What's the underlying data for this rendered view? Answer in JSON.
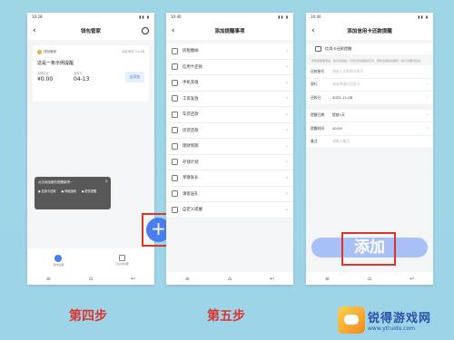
{
  "phone1": {
    "time": "10:28",
    "title": "钱包管家",
    "card": {
      "brand": "钱包管家",
      "date": "4月28日 11:08",
      "title": "这是一条示例提醒",
      "amount_label": "本期应还",
      "amount": "¥0.00",
      "date_label": "还款日",
      "date_value": "04-13",
      "button": "去添加"
    },
    "popup": {
      "title": "点击添加新的提醒事项~",
      "close": "×",
      "items": [
        "信用卡还款",
        "房租缴纳",
        "更多提醒"
      ]
    },
    "fab": "+",
    "tabs": [
      "我的提醒",
      "已完成提醒"
    ]
  },
  "phone2": {
    "time": "10:40",
    "title": "添加提醒事项",
    "items": [
      "房租缴纳",
      "信用卡还款",
      "手机充值",
      "工资发放",
      "车贷还款",
      "房贷还款",
      "理财到期",
      "存钱计划",
      "孝敬家长",
      "请客送礼",
      "自定义提醒"
    ]
  },
  "phone3": {
    "time": "10:40",
    "title": "添加信用卡还款提醒",
    "card_label": "信用卡还款提醒",
    "note": "添加提醒事项后，我们将提前一天和当天提醒您还款，帮助您避免逾期和一些不必要的损失。",
    "rows": [
      {
        "k": "还款账号",
        "v": "请输入还款账号尾号",
        "dark": false
      },
      {
        "k": "银行",
        "v": "请选择银行信用卡",
        "dark": false
      },
      {
        "k": "还款日",
        "v": "2022-12-08",
        "dark": true
      },
      {
        "k": "提醒日期",
        "v": "提前1天",
        "dark": true
      },
      {
        "k": "提醒时间",
        "v": "20:00",
        "dark": true
      },
      {
        "k": "备注",
        "v": "请输入备注",
        "dark": false
      }
    ],
    "add_button": "添加"
  },
  "steps": {
    "step4": "第四步",
    "step5": "第五步"
  },
  "watermark": {
    "cn": "锐得游戏网",
    "url": "www.ytruido.com"
  }
}
